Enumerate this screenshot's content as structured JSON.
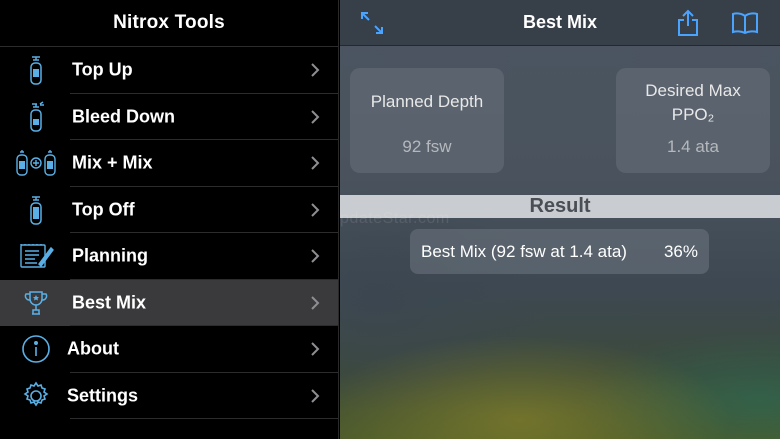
{
  "sidebar": {
    "title": "Nitrox Tools",
    "items": [
      {
        "label": "Top Up",
        "icon": "tank-icon"
      },
      {
        "label": "Bleed Down",
        "icon": "tank-bleed-icon"
      },
      {
        "label": "Mix + Mix",
        "icon": "mix-tanks-icon"
      },
      {
        "label": "Top Off",
        "icon": "tank-icon"
      },
      {
        "label": "Planning",
        "icon": "notepad-icon"
      },
      {
        "label": "Best Mix",
        "icon": "trophy-icon",
        "active": true
      },
      {
        "label": "About",
        "icon": "info-icon"
      },
      {
        "label": "Settings",
        "icon": "gear-icon"
      }
    ]
  },
  "main": {
    "title": "Best Mix",
    "planned_depth": {
      "label": "Planned Depth",
      "value": "92 fsw"
    },
    "desired_ppo2": {
      "label": "Desired Max PPO₂",
      "label_line1": "Desired Max",
      "label_line2": "PPO₂",
      "value": "1.4 ata"
    },
    "result": {
      "title": "Result",
      "label": "Best Mix (92 fsw at 1.4 ata)",
      "value": "36%"
    },
    "watermark": "UpdateStar.com"
  },
  "colors": {
    "accent": "#4aa3ff",
    "icon_blue": "#5ab0e6",
    "active_row": "#3a3a3c"
  }
}
